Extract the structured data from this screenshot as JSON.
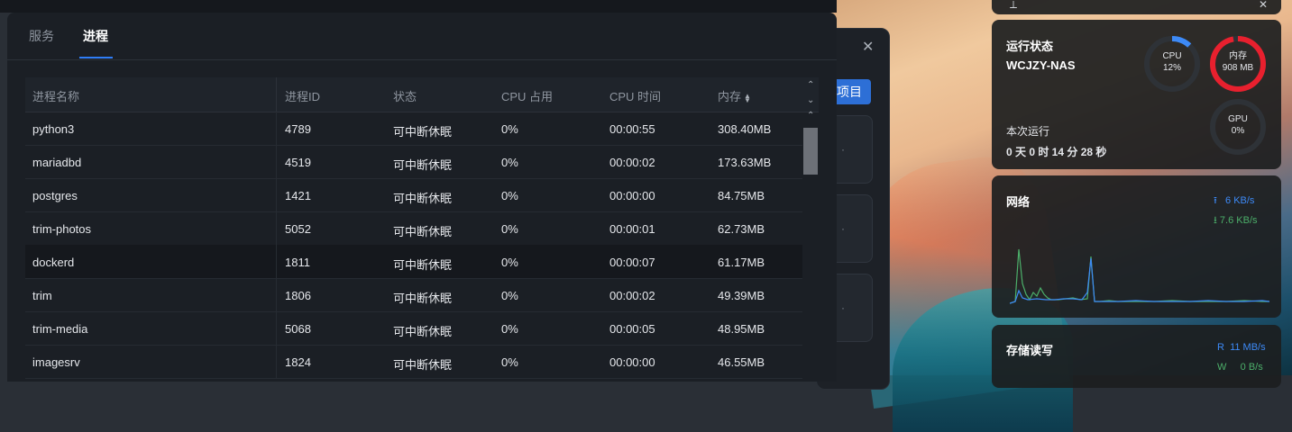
{
  "tabs": [
    "服务",
    "进程"
  ],
  "active_tab": 1,
  "columns": [
    "进程名称",
    "进程ID",
    "状态",
    "CPU 占用",
    "CPU 时间",
    "内存"
  ],
  "processes": [
    {
      "name": "python3",
      "pid": "4789",
      "state": "可中断休眠",
      "cpu": "0%",
      "time": "00:00:55",
      "mem": "308.40MB"
    },
    {
      "name": "mariadbd",
      "pid": "4519",
      "state": "可中断休眠",
      "cpu": "0%",
      "time": "00:00:02",
      "mem": "173.63MB"
    },
    {
      "name": "postgres",
      "pid": "1421",
      "state": "可中断休眠",
      "cpu": "0%",
      "time": "00:00:00",
      "mem": "84.75MB"
    },
    {
      "name": "trim-photos",
      "pid": "5052",
      "state": "可中断休眠",
      "cpu": "0%",
      "time": "00:00:01",
      "mem": "62.73MB"
    },
    {
      "name": "dockerd",
      "pid": "1811",
      "state": "可中断休眠",
      "cpu": "0%",
      "time": "00:00:07",
      "mem": "61.17MB"
    },
    {
      "name": "trim",
      "pid": "1806",
      "state": "可中断休眠",
      "cpu": "0%",
      "time": "00:00:02",
      "mem": "49.39MB"
    },
    {
      "name": "trim-media",
      "pid": "5068",
      "state": "可中断休眠",
      "cpu": "0%",
      "time": "00:00:05",
      "mem": "48.95MB"
    },
    {
      "name": "imagesrv",
      "pid": "1824",
      "state": "可中断休眠",
      "cpu": "0%",
      "time": "00:00:00",
      "mem": "46.55MB"
    }
  ],
  "back_dialog": {
    "button_label": "项目"
  },
  "status_widget": {
    "title": "运行状态",
    "hostname": "WCJZY-NAS",
    "uptime_label": "本次运行",
    "uptime": "0 天 0 时 14 分 28 秒",
    "cpu_label": "CPU",
    "cpu_value": "12%",
    "cpu_fraction": 0.12,
    "mem_label": "内存",
    "mem_value": "908 MB",
    "mem_fraction": 0.97,
    "gpu_label": "GPU",
    "gpu_value": "0%",
    "gpu_fraction": 0
  },
  "network_widget": {
    "title": "网络",
    "upload": "6 KB/s",
    "download": "7.6 KB/s"
  },
  "storage_widget": {
    "title": "存储读写",
    "read_label": "R",
    "read": "11 MB/s",
    "write_label": "W",
    "write": "0 B/s"
  },
  "colors": {
    "accent": "#2f7df6",
    "cpu_ring": "#3d8af7",
    "mem_ring": "#e8202e",
    "net_up": "#3d8af7",
    "net_down": "#4caf6a"
  }
}
